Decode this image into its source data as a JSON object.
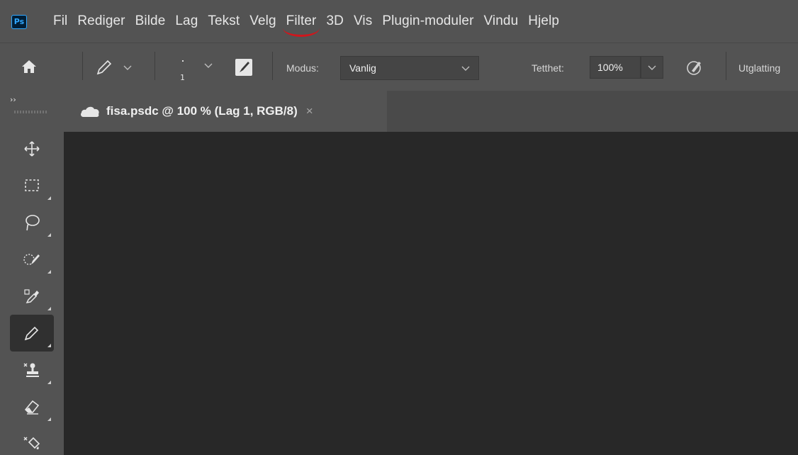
{
  "app": {
    "logo_text": "Ps"
  },
  "menu": {
    "items": [
      "Fil",
      "Rediger",
      "Bilde",
      "Lag",
      "Tekst",
      "Velg",
      "Filter",
      "3D",
      "Vis",
      "Plugin-moduler",
      "Vindu",
      "Hjelp"
    ],
    "annotated_item": "Filter",
    "annotation_color": "#d0161c"
  },
  "options": {
    "brush_size": "1",
    "modus_label": "Modus:",
    "modus_value": "Vanlig",
    "tetthet_label": "Tetthet:",
    "tetthet_value": "100%",
    "utglatting_label": "Utglatting"
  },
  "panel": {
    "collapse_glyph": "››"
  },
  "document": {
    "tab_title": "fisa.psdc @ 100 % (Lag 1, RGB/8)",
    "close_glyph": "×"
  },
  "tools": [
    {
      "name": "move-tool",
      "icon": "move-icon",
      "active": false
    },
    {
      "name": "marquee-tool",
      "icon": "rect-marquee-icon",
      "active": false
    },
    {
      "name": "lasso-tool",
      "icon": "lasso-icon",
      "active": false
    },
    {
      "name": "quick-selection-tool",
      "icon": "quick-selection-icon",
      "active": false
    },
    {
      "name": "eyedropper-tool",
      "icon": "eyedropper-icon",
      "active": false
    },
    {
      "name": "pencil-tool",
      "icon": "pencil-icon",
      "active": true
    },
    {
      "name": "clone-stamp-tool",
      "icon": "clone-stamp-icon",
      "active": false
    },
    {
      "name": "eraser-tool",
      "icon": "eraser-icon",
      "active": false
    },
    {
      "name": "paint-bucket-tool",
      "icon": "paint-bucket-icon",
      "active": false
    }
  ],
  "colors": {
    "ui_bg": "#535353",
    "canvas_bg": "#282828",
    "accent_blue": "#31a8ff"
  }
}
